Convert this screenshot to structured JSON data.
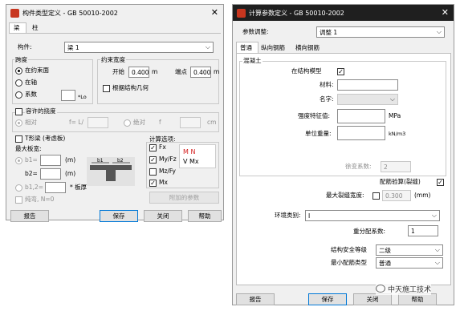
{
  "left_window": {
    "title": "构件类型定义 - GB 50010-2002",
    "tabs": [
      "梁",
      "柱"
    ],
    "member_label": "构件:",
    "member_value": "梁 1",
    "span_group": {
      "title": "跨度",
      "opt_inner_face": "在约束面",
      "opt_axis": "在轴",
      "opt_coef": "系数",
      "coef_unit": "*Lo"
    },
    "constraint_group": {
      "title": "约束宽度",
      "start_label": "开始",
      "start_value": "0.400",
      "start_unit": "m",
      "end_label": "端点",
      "end_value": "0.400",
      "end_unit": "m",
      "geometry_label": "根据结构几何"
    },
    "deflection": {
      "label": "容许的挠度",
      "relative": "相对",
      "ratio": "f= L/",
      "absolute": "绝对",
      "f_label": "f",
      "unit": "cm"
    },
    "tbeam": {
      "label": "T形梁 (考虑板)",
      "max_width": "最大板宽:",
      "b1": "b1=",
      "b1_unit": "(m)",
      "b2": "b2=",
      "b2_unit": "(m)",
      "b12": "b1,2=",
      "b12_unit": "* 板厚",
      "pure_bend": "纯弯, N=0",
      "fig_b1": "b1",
      "fig_b2": "b2"
    },
    "calc_options": {
      "title": "计算选项:",
      "items": [
        "Fx",
        "My/Fz",
        "Mz/Fy",
        "Mx"
      ],
      "checked": [
        true,
        true,
        false,
        true
      ],
      "red_text": "M N",
      "v_text": "V Mx",
      "extra_button": "附加的参数"
    },
    "buttons": {
      "report": "报告",
      "save": "保存",
      "close": "关闭",
      "help": "帮助"
    }
  },
  "right_window": {
    "title": "计算参数定义 - GB 50010-2002",
    "param_label": "参数调整:",
    "param_value": "调整 1",
    "tabs": [
      "普通",
      "纵向钢筋",
      "横向钢筋"
    ],
    "concrete_group": "混凝土",
    "in_model": "在结构模型",
    "material": "材料:",
    "name": "名字:",
    "strength": "强度特征值:",
    "strength_unit": "MPa",
    "unit_weight": "单位重量:",
    "unit_weight_unit": "kN/m3",
    "creep": "徐变系数:",
    "creep_value": "2",
    "crack_calc": "配筋验算(裂缝)",
    "max_crack": "最大裂缝宽度:",
    "max_crack_value": "0.300",
    "max_crack_unit": "(mm)",
    "env": "环境类别:",
    "env_value": "I",
    "importance": "重分配系数:",
    "importance_value": "1",
    "safety": "结构安全等级",
    "safety_value": "二级",
    "min_rebar": "最小配筋类型",
    "min_rebar_value": "普通",
    "buttons": {
      "report": "报告",
      "save": "保存",
      "close": "关闭",
      "help": "帮助"
    }
  },
  "watermark": "中天施工技术",
  "colors": {
    "icon": "#c8361f",
    "red_text": "#d42020",
    "window_bg": "#f0f0f0"
  }
}
